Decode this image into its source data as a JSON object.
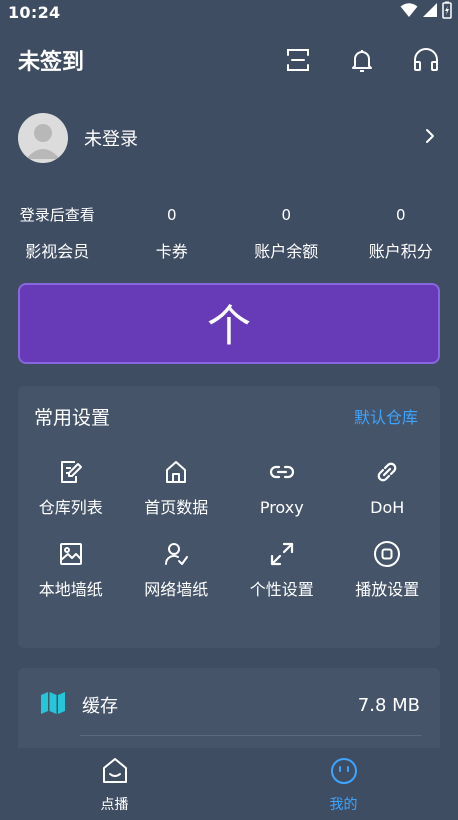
{
  "status_bar": {
    "time": "10:24"
  },
  "header": {
    "title": "未签到"
  },
  "profile": {
    "name": "未登录"
  },
  "stats": [
    {
      "value": "登录后查看",
      "label": "影视会员"
    },
    {
      "value": "0",
      "label": "卡券"
    },
    {
      "value": "0",
      "label": "账户余额"
    },
    {
      "value": "0",
      "label": "账户积分"
    }
  ],
  "banner": {
    "text": "个"
  },
  "settings": {
    "title": "常用设置",
    "link": "默认仓库",
    "items": [
      {
        "label": "仓库列表",
        "icon": "edit-document-icon"
      },
      {
        "label": "首页数据",
        "icon": "home-icon"
      },
      {
        "label": "Proxy",
        "icon": "link-icon"
      },
      {
        "label": "DoH",
        "icon": "chain-link-icon"
      },
      {
        "label": "本地墙纸",
        "icon": "image-icon"
      },
      {
        "label": "网络墙纸",
        "icon": "user-check-icon"
      },
      {
        "label": "个性设置",
        "icon": "expand-icon"
      },
      {
        "label": "播放设置",
        "icon": "stop-circle-icon"
      }
    ]
  },
  "cache": {
    "label": "缓存",
    "value": "7.8 MB"
  },
  "bottom_nav": [
    {
      "label": "点播",
      "active": false
    },
    {
      "label": "我的",
      "active": true
    }
  ],
  "colors": {
    "background": "#3f4d63",
    "card": "#46546a",
    "accent": "#3da4ff",
    "banner": "#673ab7",
    "cache_icon": "#26c6da"
  }
}
